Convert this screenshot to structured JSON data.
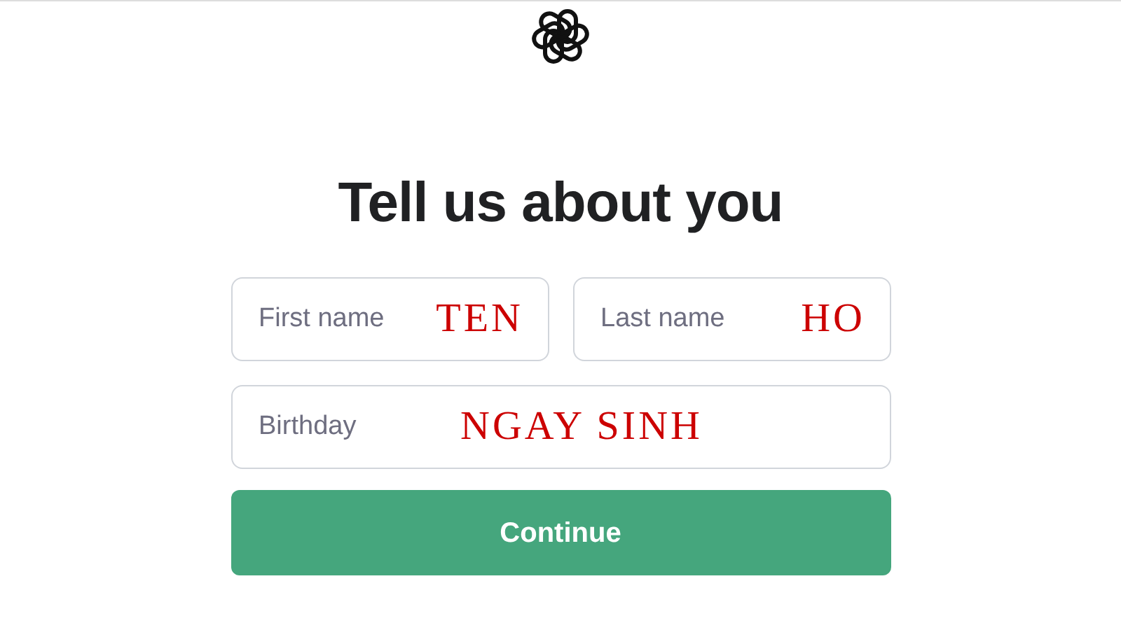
{
  "title": "Tell us about you",
  "name_fields": [
    {
      "placeholder": "First name",
      "annotation": "TEN"
    },
    {
      "placeholder": "Last name",
      "annotation": "HO"
    }
  ],
  "birthday_field": {
    "placeholder": "Birthday",
    "annotation": "NGAY SINH"
  },
  "button": "Continue"
}
